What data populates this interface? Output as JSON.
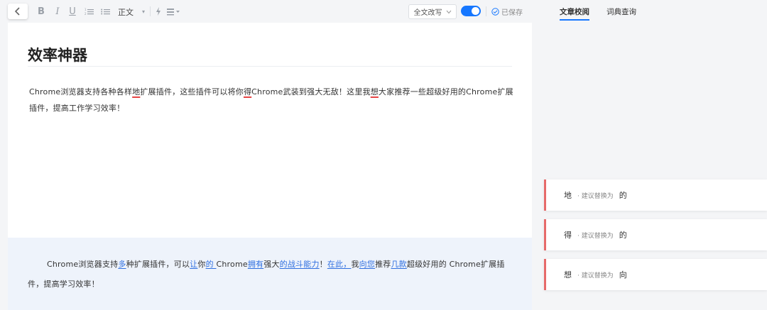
{
  "toolbar": {
    "style_label": "正文",
    "rewrite_label": "全文改写",
    "saved_label": "已保存"
  },
  "tabs": [
    {
      "label": "文章校阅",
      "active": true
    },
    {
      "label": "词典查询",
      "active": false
    }
  ],
  "editor": {
    "title": "效率神器",
    "paragraph": [
      {
        "text": "Chrome浏览器支持各种各样",
        "error": false
      },
      {
        "text": "地",
        "error": true
      },
      {
        "text": "扩展插件，这些插件可以将你",
        "error": false
      },
      {
        "text": "得",
        "error": true
      },
      {
        "text": "Chrome武装到强大无敌！这里我",
        "error": false
      },
      {
        "text": "想",
        "error": true
      },
      {
        "text": "大家推荐一些超级好用的Chrome扩展插件，提高工作学习效率！",
        "error": false
      }
    ]
  },
  "rewrite": {
    "segments": [
      {
        "text": "Chrome浏览器支持",
        "changed": false
      },
      {
        "text": "多",
        "changed": true
      },
      {
        "text": "种扩展插件，可以",
        "changed": false
      },
      {
        "text": "让",
        "changed": true
      },
      {
        "text": "你",
        "changed": false
      },
      {
        "text": "的 ",
        "changed": true
      },
      {
        "text": "Chrome",
        "changed": false
      },
      {
        "text": "拥有",
        "changed": true
      },
      {
        "text": "强大",
        "changed": false
      },
      {
        "text": "的战斗能力",
        "changed": true
      },
      {
        "text": "！",
        "changed": false
      },
      {
        "text": "在此，",
        "changed": true
      },
      {
        "text": "我",
        "changed": false
      },
      {
        "text": "向您",
        "changed": true
      },
      {
        "text": "推荐",
        "changed": false
      },
      {
        "text": "几款",
        "changed": true
      },
      {
        "text": "超级好用的 Chrome扩展插件，提高学习效率！",
        "changed": false
      }
    ]
  },
  "suggestions": [
    {
      "original": "地",
      "hint": "· 建议替换为",
      "replacement": "的"
    },
    {
      "original": "得",
      "hint": "· 建议替换为",
      "replacement": "的"
    },
    {
      "original": "想",
      "hint": "· 建议替换为",
      "replacement": "向"
    }
  ],
  "colors": {
    "accent": "#1677ff",
    "error_underline": "#e64545",
    "card_border": "#e66a6a",
    "change_link": "#2f6fe0"
  }
}
